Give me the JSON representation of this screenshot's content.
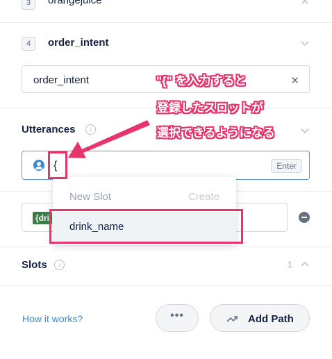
{
  "rows": [
    {
      "num": "3",
      "label": "orangejuice"
    },
    {
      "num": "4",
      "label": "order_intent"
    }
  ],
  "intent_field": {
    "value": "order_intent",
    "clear": "✕"
  },
  "utterances": {
    "title": "Utterances",
    "info": "i",
    "input_value": "{",
    "enter_label": "Enter",
    "second_value_chip": "{dri"
  },
  "dropdown": {
    "new_slot_label": "New Slot",
    "create_label": "Create",
    "slot_option": "drink_name"
  },
  "slots": {
    "title": "Slots",
    "info": "i",
    "count": "1"
  },
  "footer": {
    "how_link": "How it works?",
    "more_label": "•••",
    "add_path_label": "Add Path"
  },
  "annotation": {
    "line1": "\"{\" を入力すると",
    "line2": "登録したスロットが",
    "line3": "選択できるようになる"
  },
  "colors": {
    "accent": "#3e87d4",
    "annotation": "#e8336b",
    "slot_chip": "#3a7d44"
  }
}
